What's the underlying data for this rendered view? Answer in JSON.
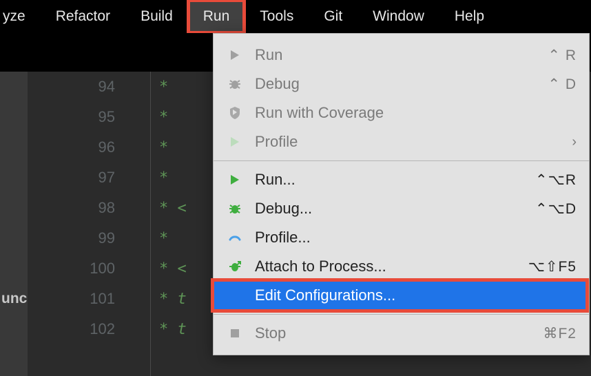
{
  "menubar": {
    "items": [
      {
        "label": "yze"
      },
      {
        "label": "Refactor"
      },
      {
        "label": "Build"
      },
      {
        "label": "Run",
        "active": true,
        "highlight": true
      },
      {
        "label": "Tools"
      },
      {
        "label": "Git"
      },
      {
        "label": "Window"
      },
      {
        "label": "Help"
      }
    ]
  },
  "gutter": {
    "lines": [
      "94",
      "95",
      "96",
      "97",
      "98",
      "99",
      "100",
      "101",
      "102"
    ]
  },
  "sidelabel": {
    "text": "unch"
  },
  "code": {
    "lines": [
      {
        "text": "*"
      },
      {
        "text": "*"
      },
      {
        "text": "*"
      },
      {
        "text": "*"
      },
      {
        "text": "* <"
      },
      {
        "text": "*"
      },
      {
        "text": "* <"
      },
      {
        "text": "* t"
      },
      {
        "text": "* t"
      }
    ]
  },
  "dropdown": {
    "items": [
      {
        "icon": "play",
        "label": "Run",
        "shortcut": "⌃ R",
        "disabled": true
      },
      {
        "icon": "bug",
        "label": "Debug",
        "shortcut": "⌃ D",
        "disabled": true
      },
      {
        "icon": "shield",
        "label": "Run with Coverage",
        "shortcut": "",
        "disabled": true
      },
      {
        "icon": "play-soft",
        "label": "Profile",
        "shortcut": "›",
        "disabled": true,
        "submenu": true
      },
      {
        "sep": true
      },
      {
        "icon": "play-green",
        "label": "Run...",
        "shortcut": "⌃⌥R"
      },
      {
        "icon": "bug-green",
        "label": "Debug...",
        "shortcut": "⌃⌥D"
      },
      {
        "icon": "arc",
        "label": "Profile...",
        "shortcut": ""
      },
      {
        "icon": "bug-attach",
        "label": "Attach to Process...",
        "shortcut": "⌥⇧F5"
      },
      {
        "icon": "",
        "label": "Edit Configurations...",
        "shortcut": "",
        "selected": true,
        "highlight": true
      },
      {
        "sep": true
      },
      {
        "icon": "stop",
        "label": "Stop",
        "shortcut": "⌘F2",
        "disabled": true
      }
    ]
  }
}
